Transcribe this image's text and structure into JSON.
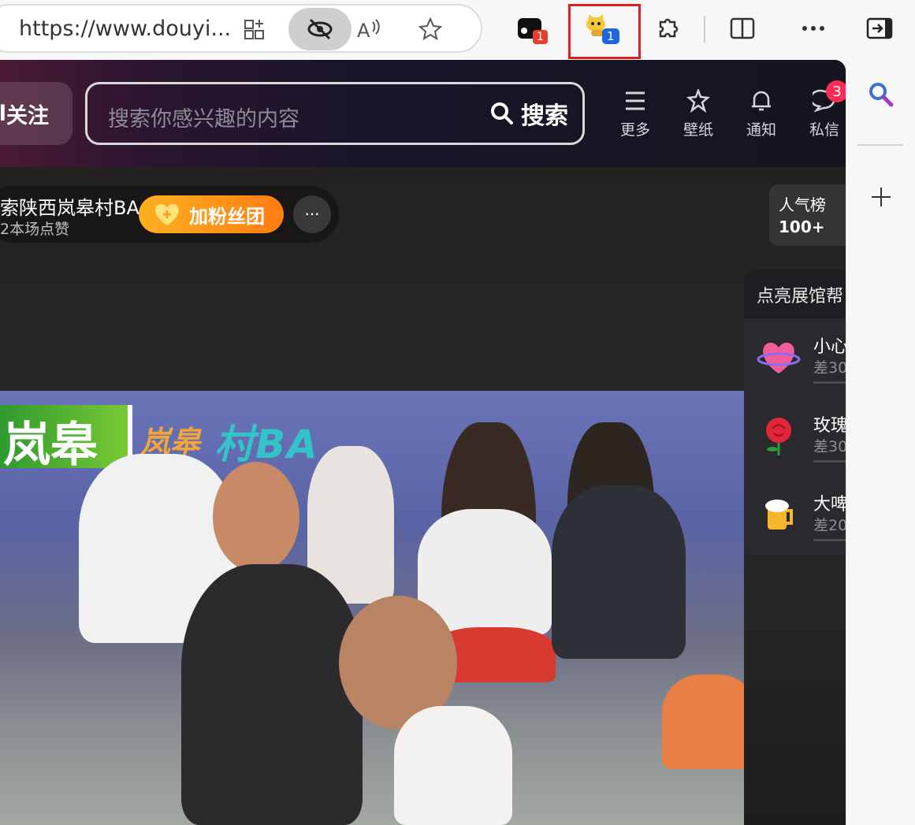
{
  "browser": {
    "url": "https://www.douyi...",
    "extension_badge_1": "1",
    "extension_badge_2": "1"
  },
  "header": {
    "follow_label": "关注",
    "follow_prefix": "l",
    "search_placeholder": "搜索你感兴趣的内容",
    "search_button": "搜索",
    "nav": [
      {
        "label": "更多",
        "icon": "menu-icon"
      },
      {
        "label": "壁纸",
        "icon": "wallpaper-icon"
      },
      {
        "label": "通知",
        "icon": "bell-icon"
      },
      {
        "label": "私信",
        "icon": "message-icon",
        "badge": "3"
      }
    ]
  },
  "live": {
    "host_name": "索陕西岚皋村BA",
    "host_likes": "2本场点赞",
    "fan_button": "加粉丝团",
    "rank_title": "人气榜",
    "rank_value": "100+",
    "panel_title": "点亮展馆帮",
    "gifts": [
      {
        "name": "小心",
        "need": "差30",
        "icon": "heart-icon"
      },
      {
        "name": "玫瑰",
        "need": "差30",
        "icon": "rose-icon"
      },
      {
        "name": "大啤",
        "need": "差20",
        "icon": "beer-icon"
      }
    ],
    "video_banner": "岚皋",
    "video_logo_cn": "岚皋",
    "video_logo_en": "村BA"
  },
  "colors": {
    "accent": "#fe2c55",
    "fan_button": "#ff9a1a",
    "highlight_box": "#e02020"
  }
}
